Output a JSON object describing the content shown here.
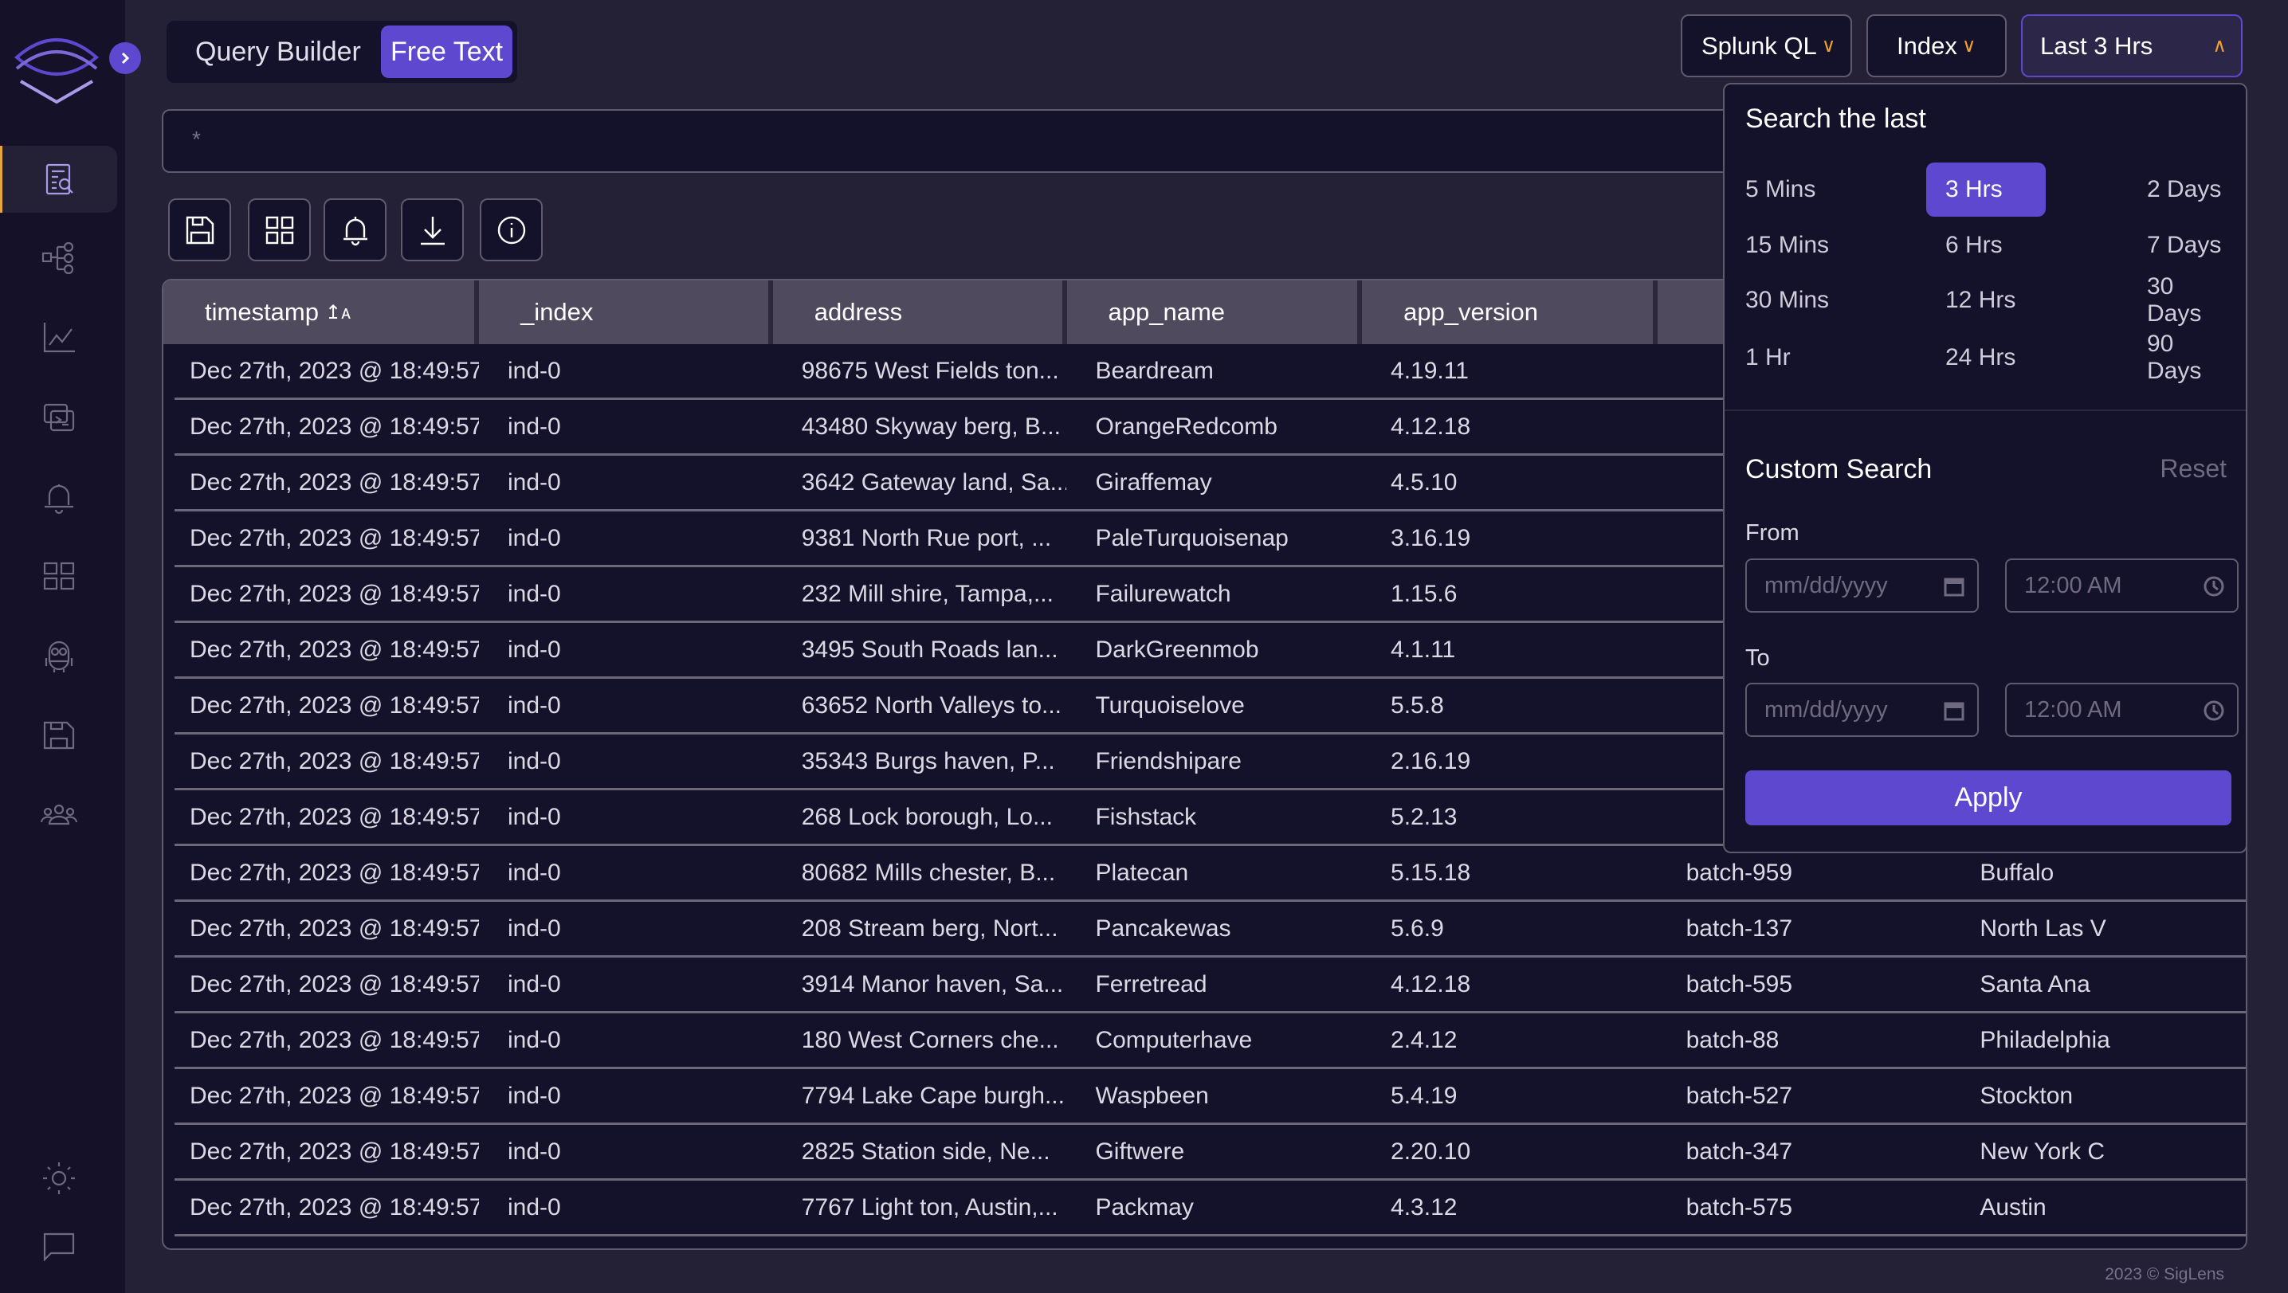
{
  "header": {
    "mode_tabs": [
      "Query Builder",
      "Free Text"
    ],
    "active_mode": "Free Text",
    "search_value": "*",
    "language_dropdown": "Splunk QL",
    "index_dropdown": "Index",
    "time_dropdown": "Last 3 Hrs"
  },
  "sidebar": {
    "items": [
      "search-icon",
      "pipeline-icon",
      "metrics-icon",
      "live-tail-icon",
      "alerts-icon",
      "dashboards-icon",
      "minion-icon",
      "saved-queries-icon",
      "users-icon"
    ],
    "bottom": [
      "theme-sun-icon",
      "feedback-icon"
    ]
  },
  "toolbar": [
    "save-icon",
    "dashboard-icon",
    "alert-icon",
    "download-icon",
    "info-icon"
  ],
  "table": {
    "columns": [
      "timestamp",
      "_index",
      "address",
      "app_name",
      "app_version",
      "",
      ""
    ],
    "rows": [
      [
        "Dec 27th, 2023 @ 18:49:57",
        "ind-0",
        "98675 West Fields ton...",
        "Beardream",
        "4.19.11",
        "",
        ""
      ],
      [
        "Dec 27th, 2023 @ 18:49:57",
        "ind-0",
        "43480 Skyway berg, B...",
        "OrangeRedcomb",
        "4.12.18",
        "",
        ""
      ],
      [
        "Dec 27th, 2023 @ 18:49:57",
        "ind-0",
        "3642 Gateway land, Sa...",
        "Giraffemay",
        "4.5.10",
        "",
        ""
      ],
      [
        "Dec 27th, 2023 @ 18:49:57",
        "ind-0",
        "9381 North Rue port, ...",
        "PaleTurquoisenap",
        "3.16.19",
        "",
        ""
      ],
      [
        "Dec 27th, 2023 @ 18:49:57",
        "ind-0",
        "232 Mill shire, Tampa,...",
        "Failurewatch",
        "1.15.6",
        "",
        ""
      ],
      [
        "Dec 27th, 2023 @ 18:49:57",
        "ind-0",
        "3495 South Roads lan...",
        "DarkGreenmob",
        "4.1.11",
        "",
        ""
      ],
      [
        "Dec 27th, 2023 @ 18:49:57",
        "ind-0",
        "63652 North Valleys to...",
        "Turquoiselove",
        "5.5.8",
        "",
        ""
      ],
      [
        "Dec 27th, 2023 @ 18:49:57",
        "ind-0",
        "35343 Burgs haven, P...",
        "Friendshipare",
        "2.16.19",
        "",
        ""
      ],
      [
        "Dec 27th, 2023 @ 18:49:57",
        "ind-0",
        "268 Lock borough, Lo...",
        "Fishstack",
        "5.2.13",
        "",
        ""
      ],
      [
        "Dec 27th, 2023 @ 18:49:57",
        "ind-0",
        "80682 Mills chester, B...",
        "Platecan",
        "5.15.18",
        "batch-959",
        "Buffalo"
      ],
      [
        "Dec 27th, 2023 @ 18:49:57",
        "ind-0",
        "208 Stream berg, Nort...",
        "Pancakewas",
        "5.6.9",
        "batch-137",
        "North Las V"
      ],
      [
        "Dec 27th, 2023 @ 18:49:57",
        "ind-0",
        "3914 Manor haven, Sa...",
        "Ferretread",
        "4.12.18",
        "batch-595",
        "Santa Ana"
      ],
      [
        "Dec 27th, 2023 @ 18:49:57",
        "ind-0",
        "180 West Corners che...",
        "Computerhave",
        "2.4.12",
        "batch-88",
        "Philadelphia"
      ],
      [
        "Dec 27th, 2023 @ 18:49:57",
        "ind-0",
        "7794 Lake Cape burgh...",
        "Waspbeen",
        "5.4.19",
        "batch-527",
        "Stockton"
      ],
      [
        "Dec 27th, 2023 @ 18:49:57",
        "ind-0",
        "2825 Station side, Ne...",
        "Giftwere",
        "2.20.10",
        "batch-347",
        "New York C"
      ],
      [
        "Dec 27th, 2023 @ 18:49:57",
        "ind-0",
        "7767 Light ton, Austin,...",
        "Packmay",
        "4.3.12",
        "batch-575",
        "Austin"
      ]
    ]
  },
  "time_picker": {
    "title": "Search the last",
    "options": [
      [
        "5 Mins",
        "3 Hrs",
        "2 Days"
      ],
      [
        "15 Mins",
        "6 Hrs",
        "7 Days"
      ],
      [
        "30 Mins",
        "12 Hrs",
        "30 Days"
      ],
      [
        "1 Hr",
        "24 Hrs",
        "90 Days"
      ]
    ],
    "selected": "3 Hrs",
    "custom_title": "Custom Search",
    "reset": "Reset",
    "from_label": "From",
    "to_label": "To",
    "date_placeholder": "mm/dd/yyyy",
    "time_value": "12:00 AM",
    "apply": "Apply"
  },
  "footer": "2023 © SigLens",
  "colors": {
    "accent": "#5e48d0",
    "chevron": "#f0a030",
    "background": "#242035",
    "sidebar": "#151128"
  }
}
